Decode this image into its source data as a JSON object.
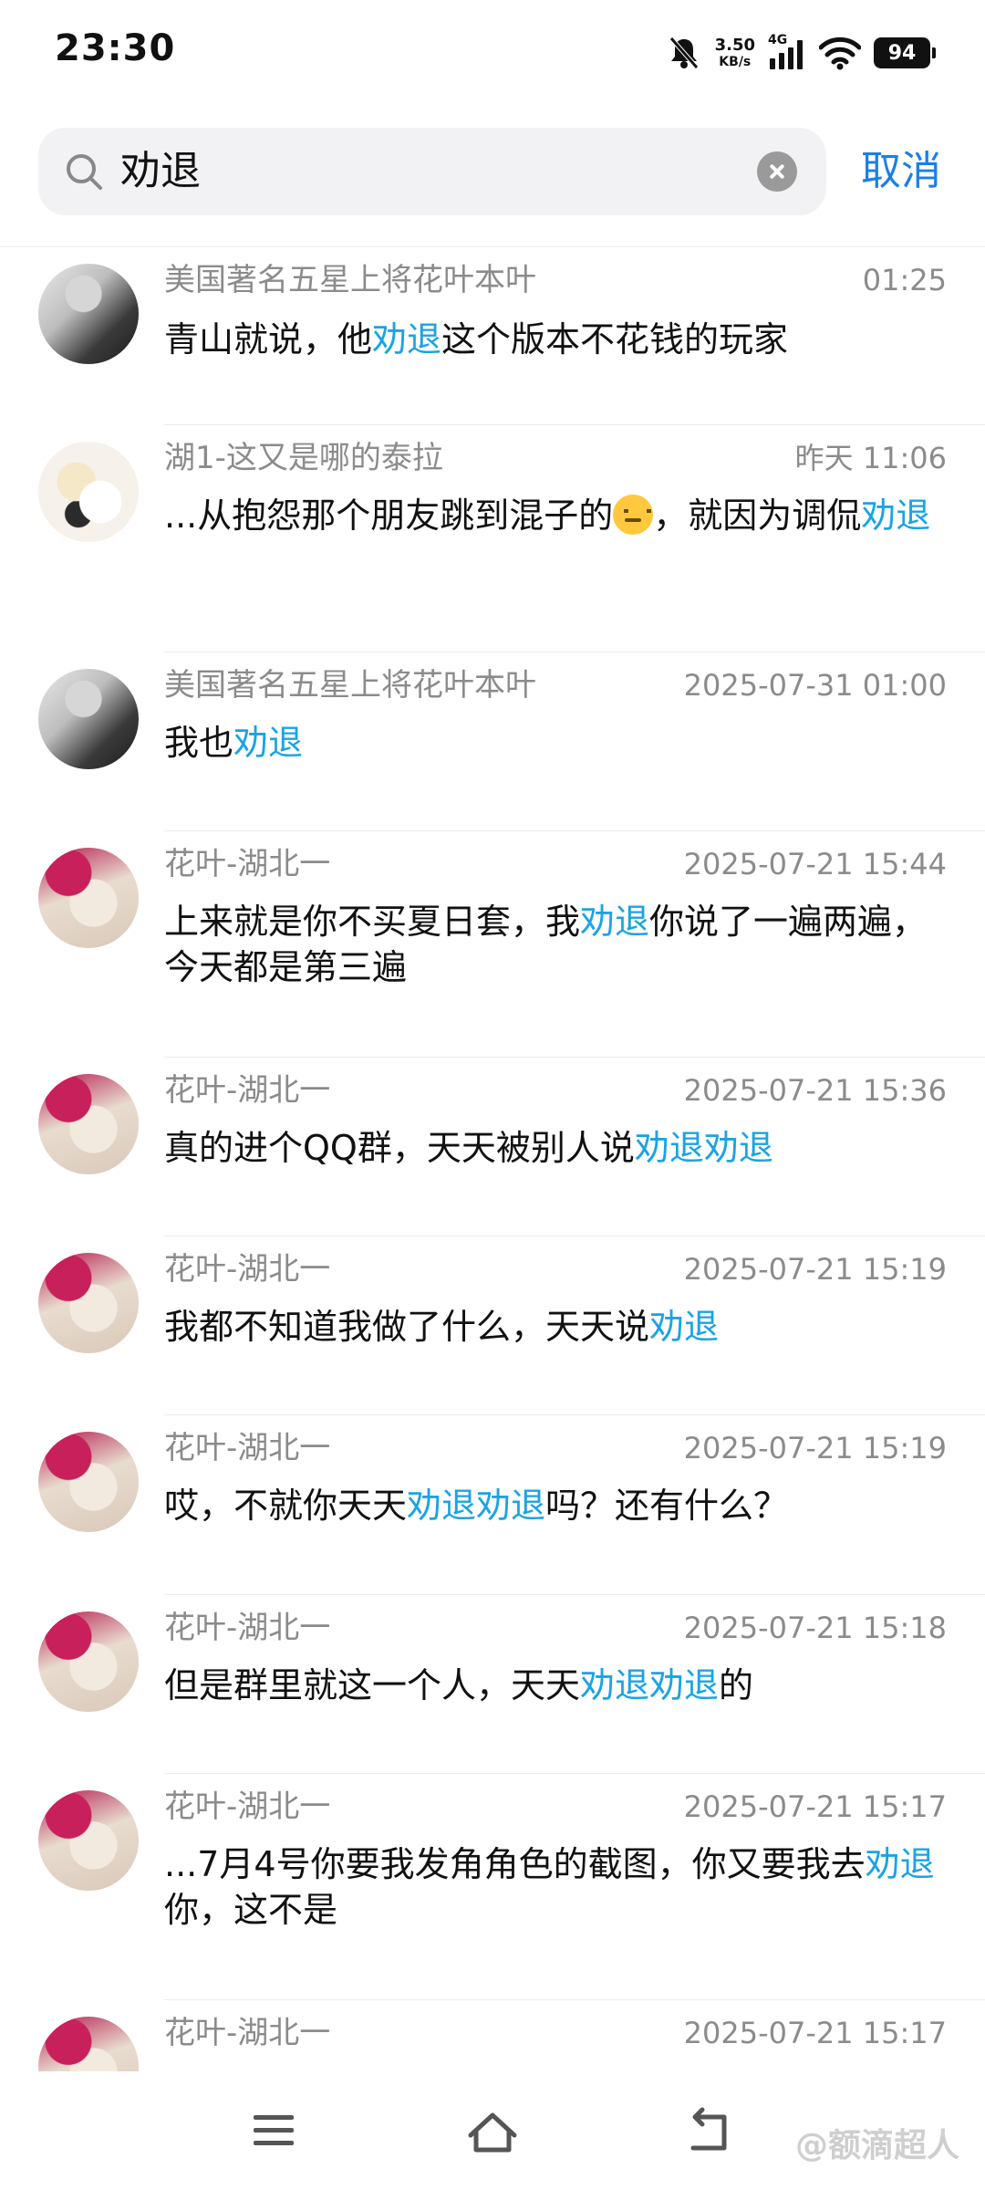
{
  "status_bar": {
    "time": "23:30",
    "net_speed_value": "3.50",
    "net_speed_unit": "KB/s",
    "network_type": "4G",
    "battery": "94",
    "icons": [
      "mute-bell-icon",
      "signal-icon",
      "wifi-icon",
      "battery-icon"
    ]
  },
  "search": {
    "query": "劝退",
    "cancel_label": "取消"
  },
  "messages": [
    {
      "sender": "美国著名五星上将花叶本叶",
      "time": "01:25",
      "segments": [
        [
          "青山就说，他",
          false
        ],
        [
          "劝退",
          true
        ],
        [
          "这个版本不花钱的玩家",
          false
        ]
      ]
    },
    {
      "sender": "湖1-这又是哪的泰拉",
      "time": "昨天 11:06",
      "pre": "...从抱怨那个朋友跳到混子的",
      "post": "，就因为调侃",
      "hl": "劝退"
    },
    {
      "sender": "美国著名五星上将花叶本叶",
      "time": "2025-07-31 01:00",
      "segments": [
        [
          "我也",
          false
        ],
        [
          "劝退",
          true
        ]
      ]
    },
    {
      "sender": "花叶-湖北一",
      "time": "2025-07-21 15:44",
      "segments": [
        [
          "上来就是你不买夏日套，我",
          false
        ],
        [
          "劝退",
          true
        ],
        [
          "你说了一遍两遍，今天都是第三遍",
          false
        ]
      ]
    },
    {
      "sender": "花叶-湖北一",
      "time": "2025-07-21 15:36",
      "segments": [
        [
          "真的进个QQ群，天天被别人说",
          false
        ],
        [
          "劝退劝退",
          true
        ]
      ]
    },
    {
      "sender": "花叶-湖北一",
      "time": "2025-07-21 15:19",
      "segments": [
        [
          "我都不知道我做了什么，天天说",
          false
        ],
        [
          "劝退",
          true
        ]
      ]
    },
    {
      "sender": "花叶-湖北一",
      "time": "2025-07-21 15:19",
      "segments": [
        [
          "哎，不就你天天",
          false
        ],
        [
          "劝退劝退",
          true
        ],
        [
          "吗？还有什么？",
          false
        ]
      ]
    },
    {
      "sender": "花叶-湖北一",
      "time": "2025-07-21 15:18",
      "segments": [
        [
          "但是群里就这一个人，天天",
          false
        ],
        [
          "劝退劝退",
          true
        ],
        [
          "的",
          false
        ]
      ]
    },
    {
      "sender": "花叶-湖北一",
      "time": "2025-07-21 15:17",
      "segments": [
        [
          "...7月4号你要我发角角色的截图，你又要我去",
          false
        ],
        [
          "劝退",
          true
        ],
        [
          "你，这不是",
          false
        ]
      ]
    },
    {
      "sender": "花叶-湖北一",
      "time": "2025-07-21 15:17",
      "segments": []
    }
  ],
  "watermark": "@额滴超人",
  "colors": {
    "highlight": "#1ba3e4",
    "cancel": "#1a7fe8",
    "meta_text": "#8b8b8b"
  }
}
